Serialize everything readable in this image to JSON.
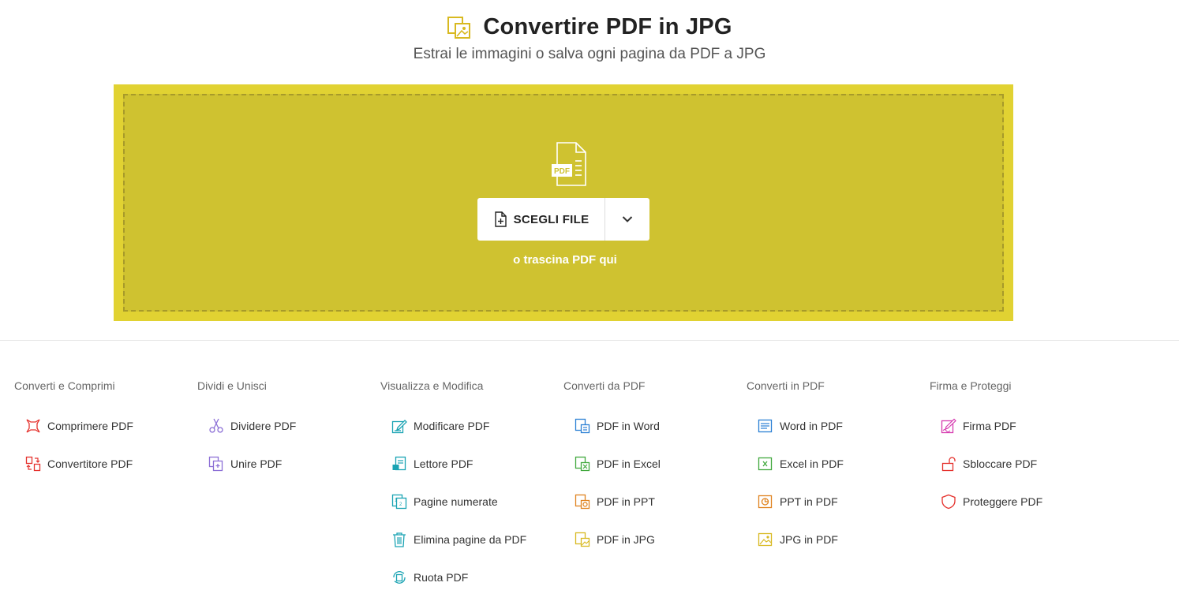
{
  "header": {
    "title": "Convertire PDF in JPG",
    "subtitle": "Estrai le immagini o salva ogni pagina da PDF a JPG",
    "title_icon": "image-icon"
  },
  "dropzone": {
    "file_icon": "pdf-file-icon",
    "file_icon_text": "PDF",
    "choose_label": "SCEGLI FILE",
    "choose_icon": "add-file-icon",
    "options_icon": "chevron-down-icon",
    "drag_hint": "o trascina PDF qui",
    "colors": {
      "outer": "#e1d232",
      "inner": "#cfc230",
      "border": "#a79a2a"
    }
  },
  "categories": [
    {
      "heading": "Converti e Comprimi",
      "tools": [
        {
          "label": "Comprimere PDF",
          "icon": "compress-icon",
          "color": "#e5322d"
        },
        {
          "label": "Convertitore PDF",
          "icon": "convert-icon",
          "color": "#e5322d"
        }
      ]
    },
    {
      "heading": "Dividi e Unisci",
      "tools": [
        {
          "label": "Dividere PDF",
          "icon": "scissors-icon",
          "color": "#8c6fd6"
        },
        {
          "label": "Unire PDF",
          "icon": "merge-icon",
          "color": "#8c6fd6"
        }
      ]
    },
    {
      "heading": "Visualizza e Modifica",
      "tools": [
        {
          "label": "Modificare PDF",
          "icon": "edit-icon",
          "color": "#1aa3b3"
        },
        {
          "label": "Lettore PDF",
          "icon": "reader-icon",
          "color": "#1aa3b3"
        },
        {
          "label": "Pagine numerate",
          "icon": "page-numbers-icon",
          "color": "#1aa3b3"
        },
        {
          "label": "Elimina pagine da PDF",
          "icon": "trash-icon",
          "color": "#1aa3b3"
        },
        {
          "label": "Ruota PDF",
          "icon": "rotate-icon",
          "color": "#1aa3b3"
        }
      ]
    },
    {
      "heading": "Converti da PDF",
      "tools": [
        {
          "label": "PDF in Word",
          "icon": "pdf-to-word-icon",
          "color": "#2a7fd4"
        },
        {
          "label": "PDF in Excel",
          "icon": "pdf-to-excel-icon",
          "color": "#41a83d"
        },
        {
          "label": "PDF in PPT",
          "icon": "pdf-to-ppt-icon",
          "color": "#e0831f"
        },
        {
          "label": "PDF in JPG",
          "icon": "pdf-to-jpg-icon",
          "color": "#d8b920"
        }
      ]
    },
    {
      "heading": "Converti in PDF",
      "tools": [
        {
          "label": "Word in PDF",
          "icon": "word-to-pdf-icon",
          "color": "#2a7fd4"
        },
        {
          "label": "Excel in PDF",
          "icon": "excel-to-pdf-icon",
          "color": "#41a83d"
        },
        {
          "label": "PPT in PDF",
          "icon": "ppt-to-pdf-icon",
          "color": "#e0831f"
        },
        {
          "label": "JPG in PDF",
          "icon": "jpg-to-pdf-icon",
          "color": "#d8b920"
        }
      ]
    },
    {
      "heading": "Firma e Proteggi",
      "tools": [
        {
          "label": "Firma PDF",
          "icon": "sign-icon",
          "color": "#d63bb0"
        },
        {
          "label": "Sbloccare PDF",
          "icon": "unlock-icon",
          "color": "#e5322d"
        },
        {
          "label": "Proteggere PDF",
          "icon": "shield-icon",
          "color": "#e5322d"
        }
      ]
    }
  ]
}
